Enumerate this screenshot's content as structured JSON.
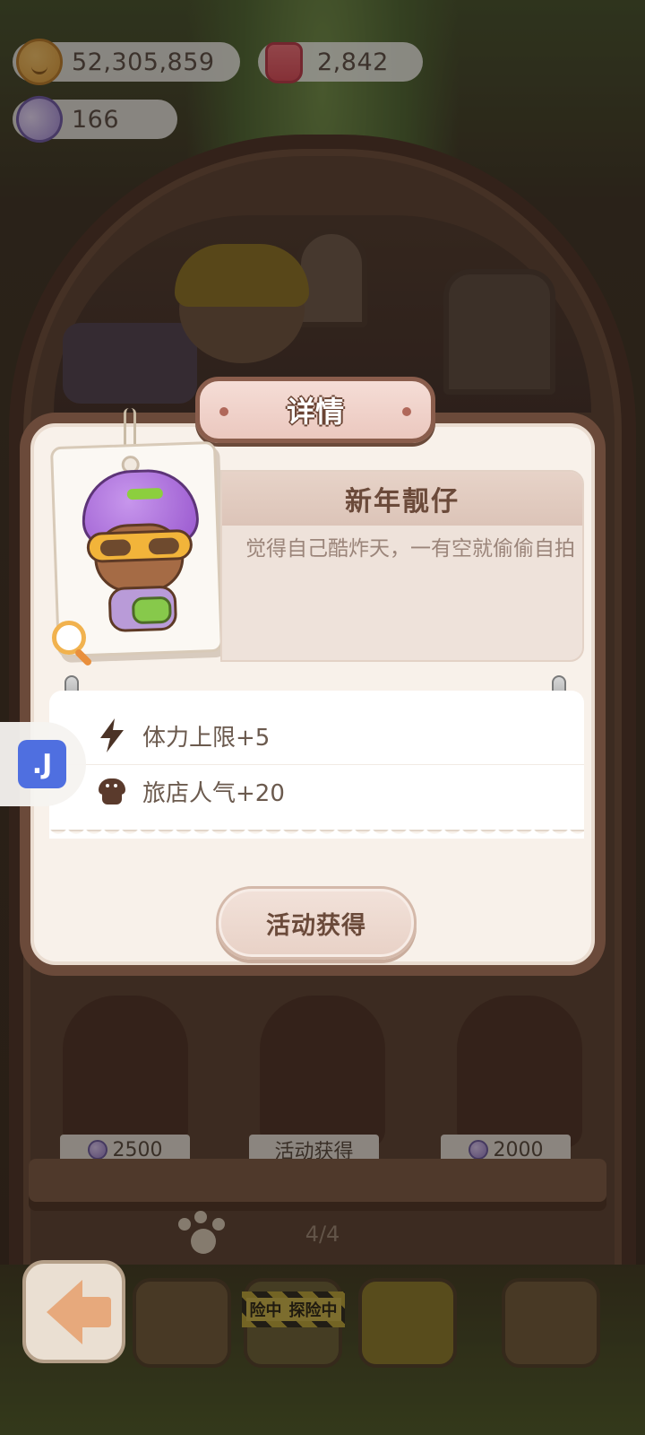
{
  "currencies": {
    "coins": "52,305,859",
    "jam": "2,842",
    "candy": "166"
  },
  "modal": {
    "title": "详情",
    "item_name": "新年靓仔",
    "item_description": "觉得自己酷炸天，一有空就偷偷自拍",
    "stats": [
      {
        "icon": "lightning-bolt-icon",
        "label": "体力上限+5"
      },
      {
        "icon": "muffin-popularity-icon",
        "label": "旅店人气+20"
      }
    ],
    "source_button": "活动获得"
  },
  "shelf": {
    "items": [
      {
        "price": "2500",
        "currency_icon": "candy-icon"
      },
      {
        "price": "活动获得",
        "currency_icon": ""
      },
      {
        "price": "2000",
        "currency_icon": "candy-icon"
      }
    ],
    "page_indicator": "4/4"
  },
  "bottom_bar": {
    "explore_label": "探险中",
    "explore_label_partial": "险中"
  },
  "side_assistant": {
    "glyph": ".J"
  },
  "colors": {
    "modal_border": "#6b4a3a",
    "modal_bg": "#f8f1ea",
    "title_plate": "#ebc8bf",
    "text_brown": "#6b4a3a",
    "desc_text": "#9b857a"
  }
}
